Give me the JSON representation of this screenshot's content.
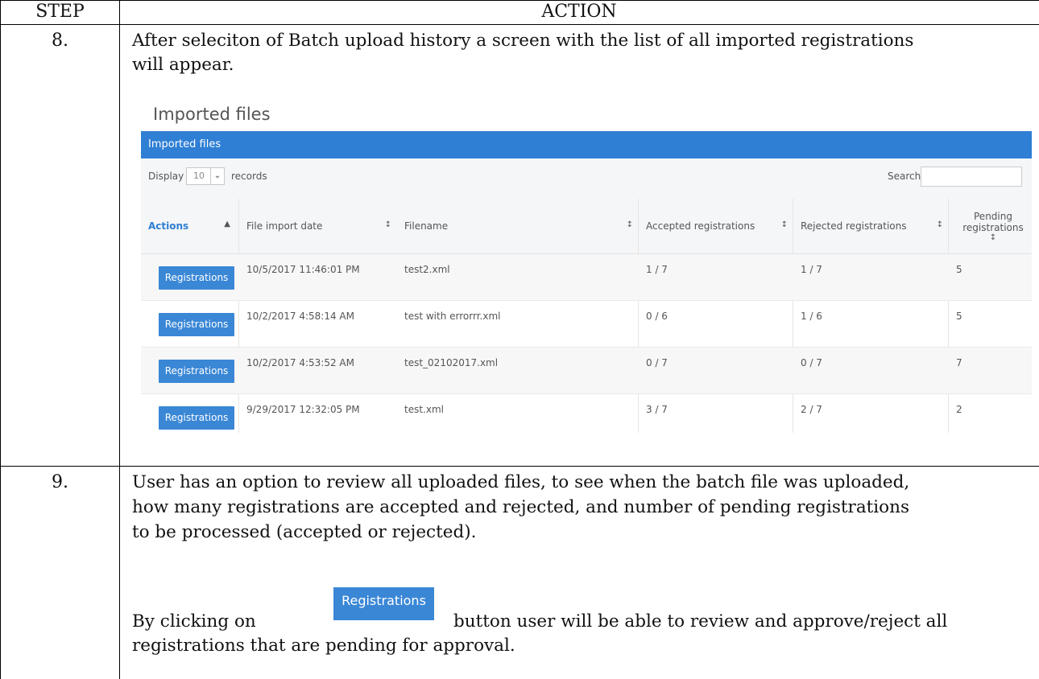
{
  "header": {
    "step": "STEP",
    "action": "ACTION"
  },
  "step8": {
    "number": "8.",
    "line1": "After seleciton of Batch upload history a screen with the list of all imported registrations",
    "line2": "will appear."
  },
  "screenshot": {
    "page_title": "Imported files",
    "panel_title": "Imported files",
    "display_label": "Display",
    "display_value": "10",
    "records_label": "records",
    "search_label": "Search:",
    "columns": [
      "Actions",
      "File import date",
      "Filename",
      "Accepted registrations",
      "Rejected registrations",
      "Pending registrations"
    ],
    "rows": [
      {
        "action": "Registrations",
        "date": "10/5/2017 11:46:01 PM",
        "filename": "test2.xml",
        "accepted": "1 / 7",
        "rejected": "1 / 7",
        "pending": "5"
      },
      {
        "action": "Registrations",
        "date": "10/2/2017 4:58:14 AM",
        "filename": "test with errorrr.xml",
        "accepted": "0 / 6",
        "rejected": "1 / 6",
        "pending": "5"
      },
      {
        "action": "Registrations",
        "date": "10/2/2017 4:53:52 AM",
        "filename": "test_02102017.xml",
        "accepted": "0 / 7",
        "rejected": "0 / 7",
        "pending": "7"
      },
      {
        "action": "Registrations",
        "date": "9/29/2017 12:32:05 PM",
        "filename": "test.xml",
        "accepted": "3 / 7",
        "rejected": "2 / 7",
        "pending": "2"
      }
    ]
  },
  "step9": {
    "number": "9.",
    "line1": "User has an option to review all uploaded files, to see when the batch file was uploaded,",
    "line2": "how many registrations are accepted and rejected, and number of pending registrations",
    "line3": "to be processed (accepted or rejected).",
    "click_prefix": "By clicking on",
    "inline_button": "Registrations",
    "click_suffix": "button user will be able to review and approve/reject all",
    "line5": "registrations that are pending for approval."
  }
}
